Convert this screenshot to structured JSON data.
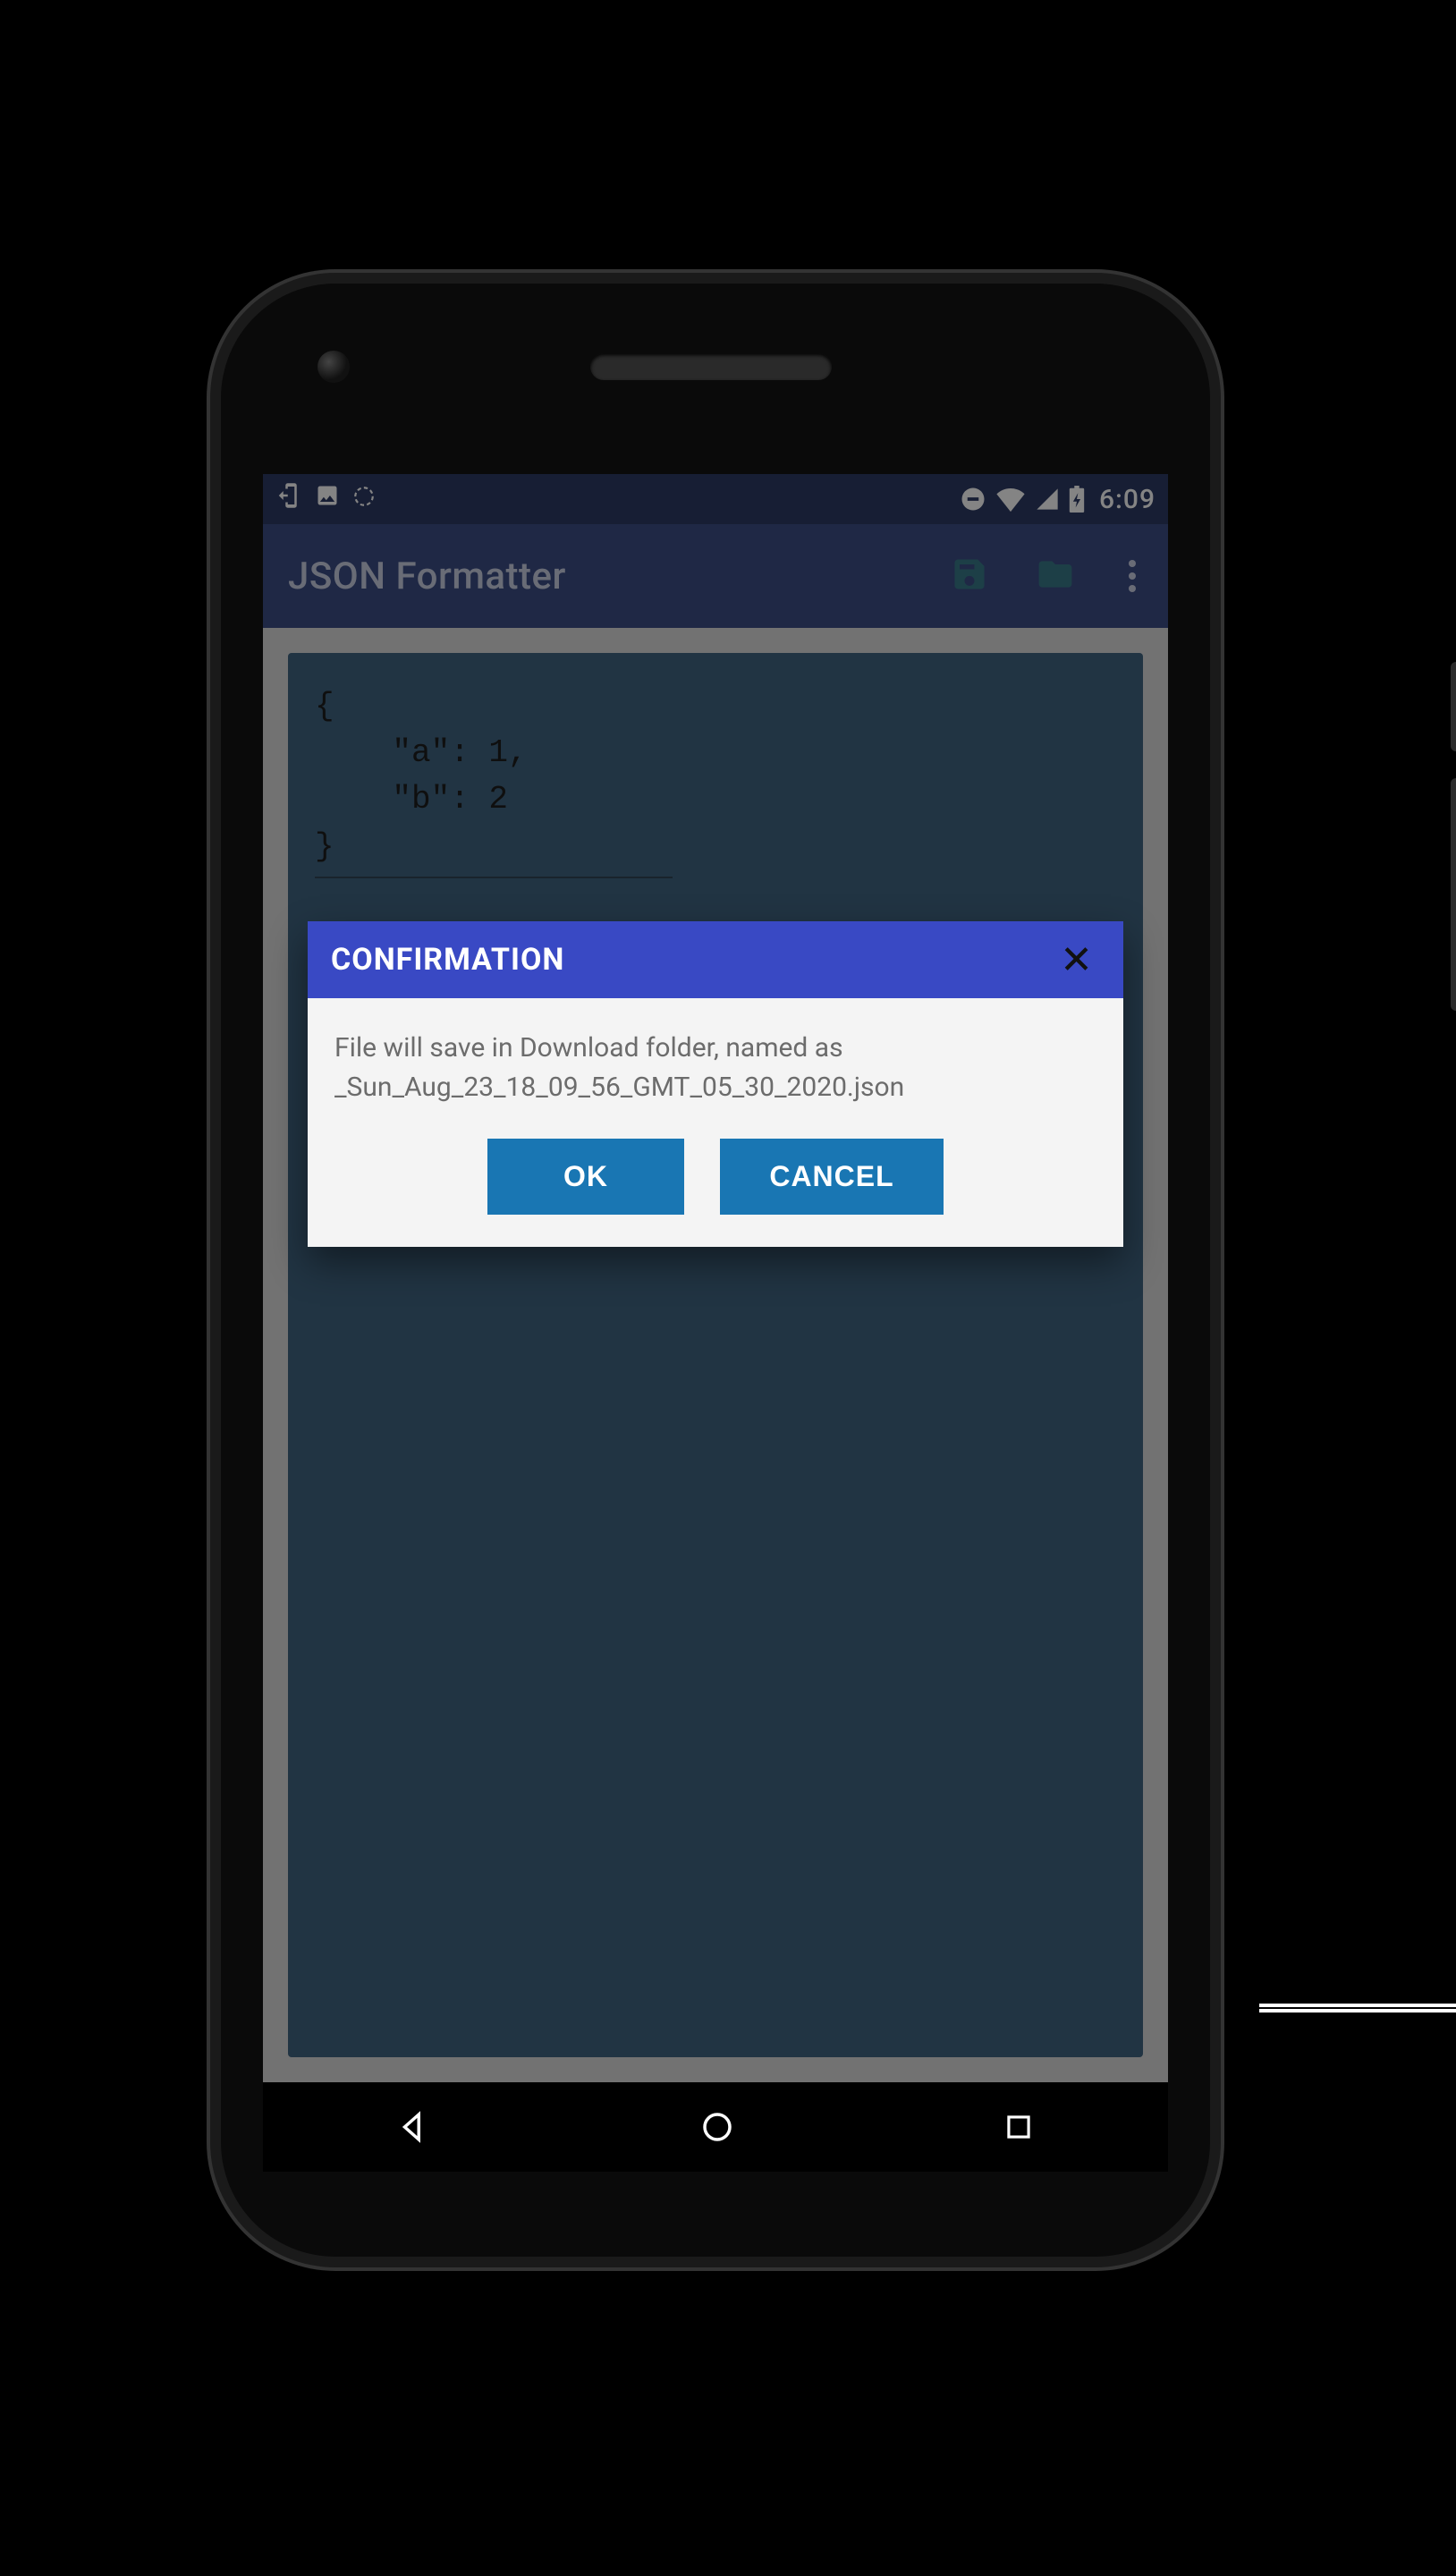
{
  "statusbar": {
    "clock": "6:09"
  },
  "appbar": {
    "title": "JSON Formatter"
  },
  "editor": {
    "content": "{\n    \"a\": 1,\n    \"b\": 2\n}"
  },
  "dialog": {
    "title": "CONFIRMATION",
    "message": "File will save in Download folder, named as _Sun_Aug_23_18_09_56_GMT_05_30_2020.json",
    "ok_label": "OK",
    "cancel_label": "CANCEL"
  }
}
